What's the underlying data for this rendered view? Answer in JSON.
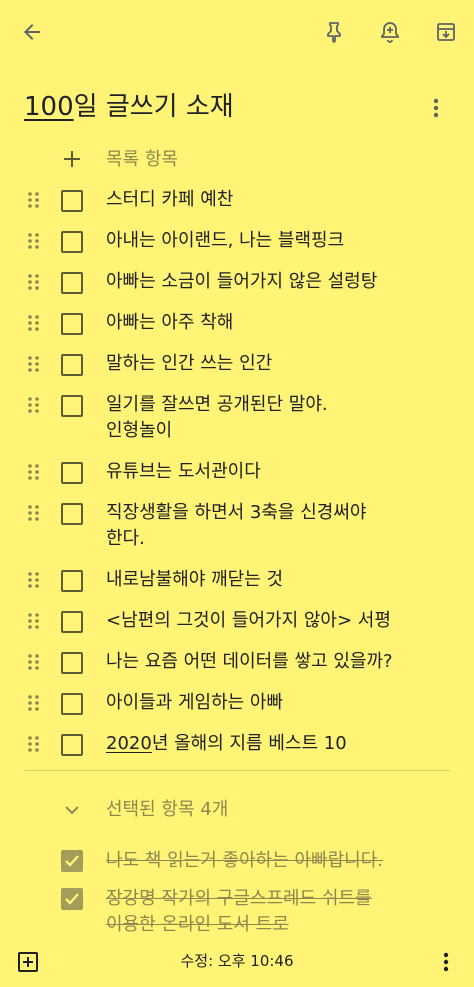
{
  "note": {
    "title_num": "100",
    "title_rest": "일 글쓰기 소재",
    "add_item_label": "목록 항목",
    "items": [
      {
        "text": "스터디 카페 예찬"
      },
      {
        "text": "아내는 아이랜드, 나는 블랙핑크"
      },
      {
        "text": "아빠는 소금이 들어가지 않은 설렁탕"
      },
      {
        "text": "아빠는 아주 착해"
      },
      {
        "text": "말하는 인간 쓰는 인간"
      },
      {
        "text": "일기를 잘쓰면 공개된단 말야.\n인형놀이"
      },
      {
        "text": "유튜브는 도서관이다"
      },
      {
        "text": "직장생활을 하면서 3축을 신경써야\n한다."
      },
      {
        "text": "내로남불해야 깨닫는 것"
      },
      {
        "text": "<남편의 그것이 들어가지 않아> 서평"
      },
      {
        "text": "나는 요즘 어떤 데이터를 쌓고 있을까?"
      },
      {
        "text": "아이들과 게임하는 아빠"
      },
      {
        "text_num": "2020",
        "text_rest": "년 올해의 지름 베스트 10"
      }
    ],
    "checked_header": "선택된 항목 4개",
    "checked_items": [
      {
        "text": "나도 책 읽는거 좋아하는 아빠랍니다."
      },
      {
        "text": "장강명 작가의 구글스프레드 쉬트를\n이용한 온라인 도서 트로"
      }
    ]
  },
  "bottom": {
    "edited": "수정: 오후 10:46"
  },
  "icons": {
    "back": "arrow-left-icon",
    "pin": "pin-icon",
    "reminder": "bell-plus-icon",
    "archive": "archive-icon",
    "more": "more-vert-icon",
    "add": "plus-icon",
    "collapse": "chevron-down-icon",
    "drag": "drag-handle-icon",
    "add_box": "add-box-icon"
  },
  "colors": {
    "background": "#FFF476",
    "muted_text": "#8d8750",
    "checked_box": "#a39f5a"
  }
}
